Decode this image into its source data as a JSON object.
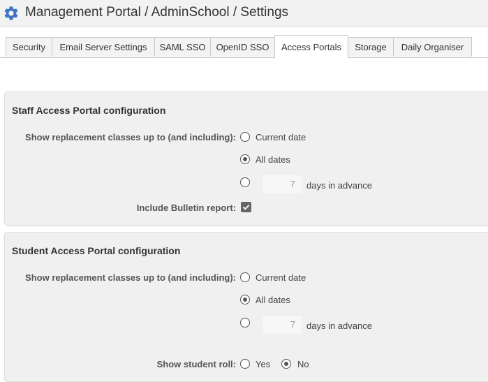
{
  "header": {
    "title": "Management Portal / AdminSchool / Settings",
    "icon": "gear-icon",
    "icon_color": "#3f73c4"
  },
  "tabs": [
    {
      "label": "Security"
    },
    {
      "label": "Email Server Settings"
    },
    {
      "label": "SAML SSO"
    },
    {
      "label": "OpenID SSO"
    },
    {
      "label": "Access Portals",
      "active": true
    },
    {
      "label": "Storage"
    },
    {
      "label": "Daily Organiser"
    }
  ],
  "staff": {
    "title": "Staff Access Portal configuration",
    "show_label": "Show replacement classes up to (and including):",
    "options": [
      "Current date",
      "All dates"
    ],
    "selected": "All dates",
    "days_value": "7",
    "days_suffix": "days in advance",
    "bulletin_label": "Include Bulletin report:",
    "bulletin_checked": true
  },
  "student": {
    "title": "Student Access Portal configuration",
    "show_label": "Show replacement classes up to (and including):",
    "options": [
      "Current date",
      "All dates"
    ],
    "selected": "All dates",
    "days_value": "7",
    "days_suffix": "days in advance",
    "roll_label": "Show student roll:",
    "roll_options": [
      "Yes",
      "No"
    ],
    "roll_selected": "No"
  },
  "colors": {
    "accent": "#3f73c4",
    "panel_bg": "#f0f0f0",
    "radio": "#555555"
  }
}
